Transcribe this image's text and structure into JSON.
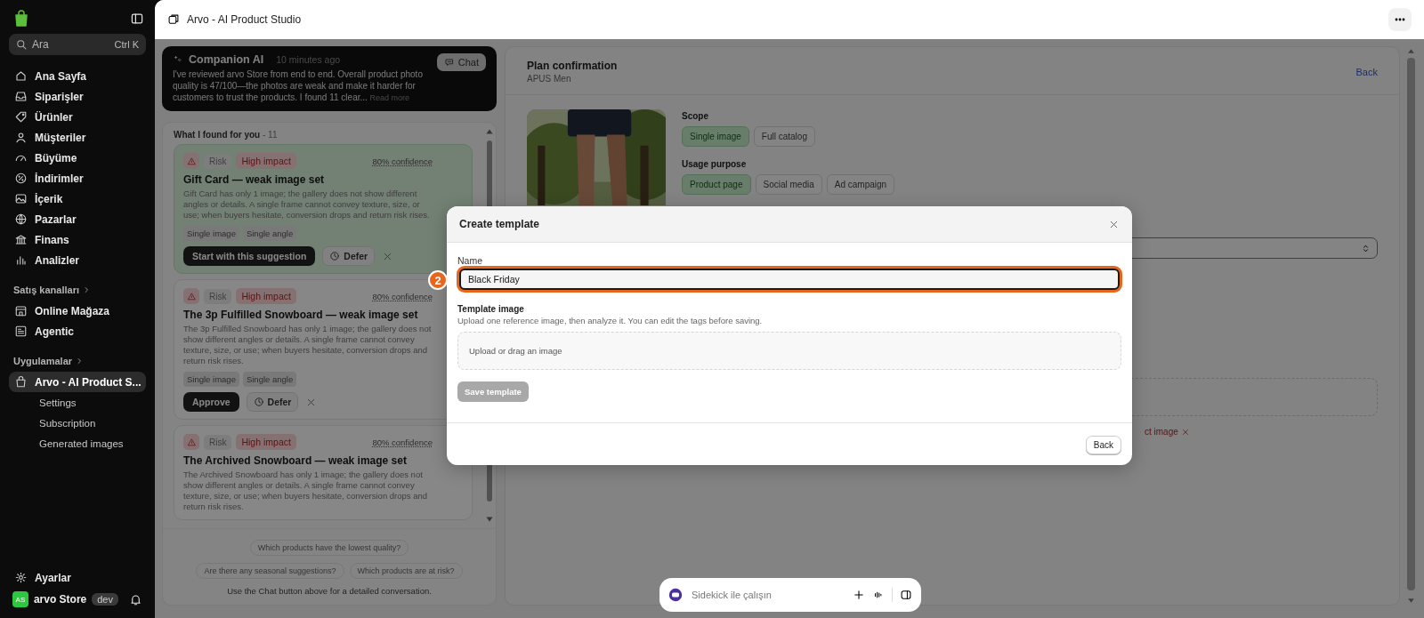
{
  "sidebar": {
    "search": {
      "placeholder": "Ara",
      "shortcut": "Ctrl K"
    },
    "nav": [
      {
        "label": "Ana Sayfa",
        "selected": false
      },
      {
        "label": "Siparişler",
        "selected": false
      },
      {
        "label": "Ürünler",
        "selected": false
      },
      {
        "label": "Müşteriler",
        "selected": false
      },
      {
        "label": "Büyüme",
        "selected": false
      },
      {
        "label": "İndirimler",
        "selected": false
      },
      {
        "label": "İçerik",
        "selected": false
      },
      {
        "label": "Pazarlar",
        "selected": false
      },
      {
        "label": "Finans",
        "selected": false
      },
      {
        "label": "Analizler",
        "selected": false
      }
    ],
    "sales_channels": {
      "heading": "Satış kanalları",
      "items": [
        {
          "label": "Online Mağaza",
          "selected": false
        },
        {
          "label": "Agentic",
          "selected": false
        }
      ]
    },
    "apps": {
      "heading": "Uygulamalar",
      "items": [
        {
          "label": "Arvo - AI Product S...",
          "selected": true,
          "children": [
            {
              "label": "Settings"
            },
            {
              "label": "Subscription"
            },
            {
              "label": "Generated images"
            }
          ]
        }
      ]
    },
    "settings": "Ayarlar",
    "store": {
      "initials": "AS",
      "name": "arvo Store",
      "badge": "dev"
    }
  },
  "app_bar": {
    "title": "Arvo - AI Product Studio"
  },
  "companion": {
    "title": "Companion AI",
    "time": "10 minutes ago",
    "message": "I've reviewed arvo Store from end to end. Overall product photo quality is 47/100—the photos are weak and make it harder for customers to trust the products. I found 11 clear...",
    "read_more": "Read more",
    "chat_button": "Chat"
  },
  "findings": {
    "heading": "What I found for you",
    "count": "- 11",
    "cards": [
      {
        "selected": true,
        "type": "Risk",
        "impact": "High impact",
        "confidence": "80% confidence",
        "title": "Gift Card — weak image set",
        "body": "Gift Card has only 1 image; the gallery does not show different angles or details. A single frame cannot convey texture, size, or use; when buyers hesitate, conversion drops and return risk rises.",
        "tags": [
          "Single image",
          "Single angle"
        ],
        "primary_action": "Start with this suggestion",
        "defer": "Defer"
      },
      {
        "selected": false,
        "type": "Risk",
        "impact": "High impact",
        "confidence": "80% confidence",
        "title": "The 3p Fulfilled Snowboard — weak image set",
        "body": "The 3p Fulfilled Snowboard has only 1 image; the gallery does not show different angles or details. A single frame cannot convey texture, size, or use; when buyers hesitate, conversion drops and return risk rises.",
        "tags": [
          "Single image",
          "Single angle"
        ],
        "primary_action": "Approve",
        "defer": "Defer"
      },
      {
        "selected": false,
        "type": "Risk",
        "impact": "High impact",
        "confidence": "80% confidence",
        "title": "The Archived Snowboard — weak image set",
        "body": "The Archived Snowboard has only 1 image; the gallery does not show different angles or details. A single frame cannot convey texture, size, or use; when buyers hesitate, conversion drops and return risk rises."
      }
    ],
    "suggestions": [
      "Which products have the lowest quality?",
      "Are there any seasonal suggestions?",
      "Which products are at risk?"
    ],
    "hint": "Use the Chat button above for a detailed conversation."
  },
  "plan": {
    "title": "Plan confirmation",
    "subtitle": "APUS Men",
    "back": "Back",
    "scope": {
      "label": "Scope",
      "options": [
        {
          "label": "Single image",
          "selected": true
        },
        {
          "label": "Full catalog",
          "selected": false
        }
      ]
    },
    "usage": {
      "label": "Usage purpose",
      "options": [
        {
          "label": "Product page",
          "selected": true
        },
        {
          "label": "Social media",
          "selected": false
        },
        {
          "label": "Ad campaign",
          "selected": false
        }
      ]
    },
    "fragment": "ct image"
  },
  "modal": {
    "title": "Create template",
    "name_label": "Name",
    "name_value": "Black Friday",
    "step_badge": "2",
    "image_label": "Template image",
    "image_help": "Upload one reference image, then analyze it. You can edit the tags before saving.",
    "dropzone": "Upload or drag an image",
    "save_button": {
      "label": "Save template",
      "disabled": true
    },
    "back_button": "Back"
  },
  "sidekick": {
    "placeholder": "Sidekick ile çalışın"
  }
}
